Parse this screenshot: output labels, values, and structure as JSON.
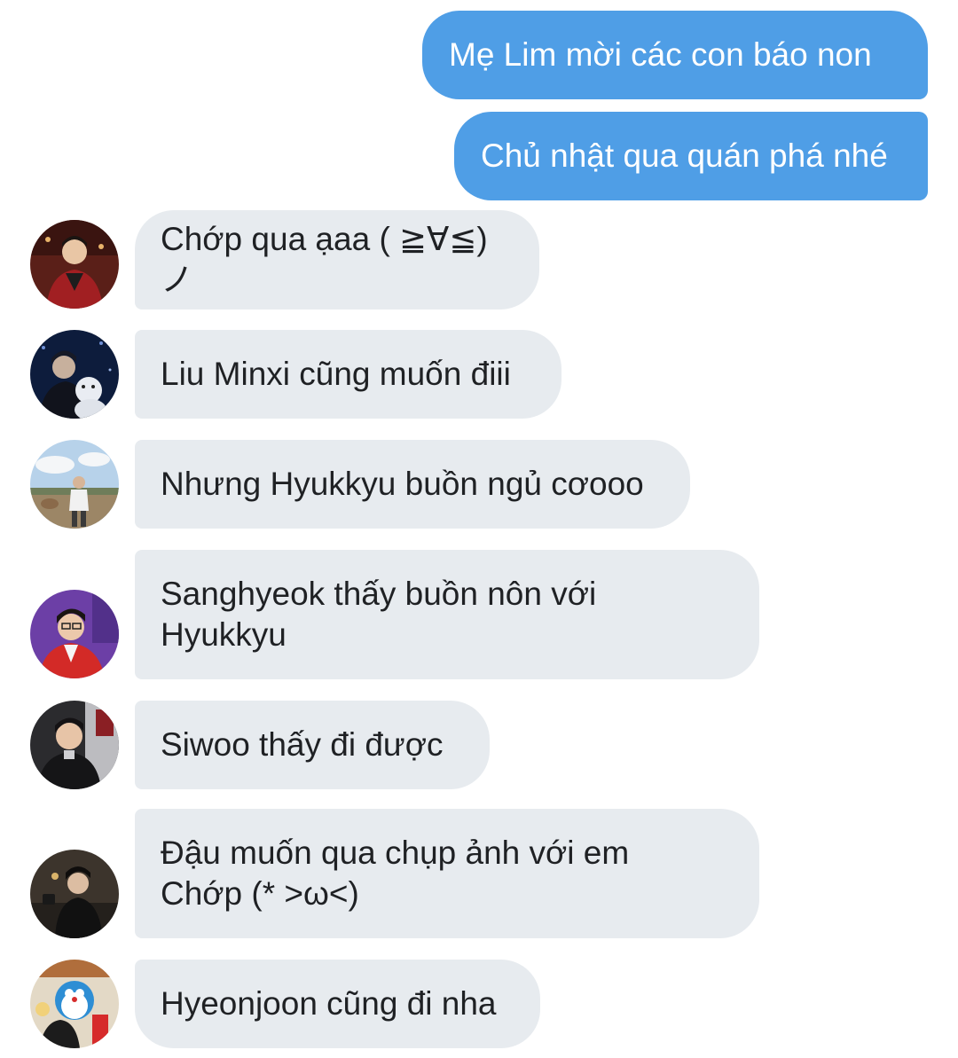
{
  "conversation": {
    "outgoing": [
      {
        "text": "Mẹ Lim mời các con báo non"
      },
      {
        "text": "Chủ nhật qua quán phá nhé"
      }
    ],
    "incoming": [
      {
        "text": "Chớp qua ạaa ( ≧∀≦)ノ"
      },
      {
        "text": "Liu Minxi cũng muốn điii"
      },
      {
        "text": "Nhưng Hyukkyu buồn ngủ cơooo"
      },
      {
        "text": "Sanghyeok thấy buồn nôn với Hyukkyu"
      },
      {
        "text": "Siwoo thấy đi được"
      },
      {
        "text": "Đậu muốn qua chụp ảnh với em Chớp (* >ω<)"
      },
      {
        "text": "Hyeonjoon cũng đi nha"
      }
    ]
  },
  "colors": {
    "outgoing_bubble": "#4f9ee6",
    "incoming_bubble": "#e7ebef",
    "background": "#ffffff"
  }
}
